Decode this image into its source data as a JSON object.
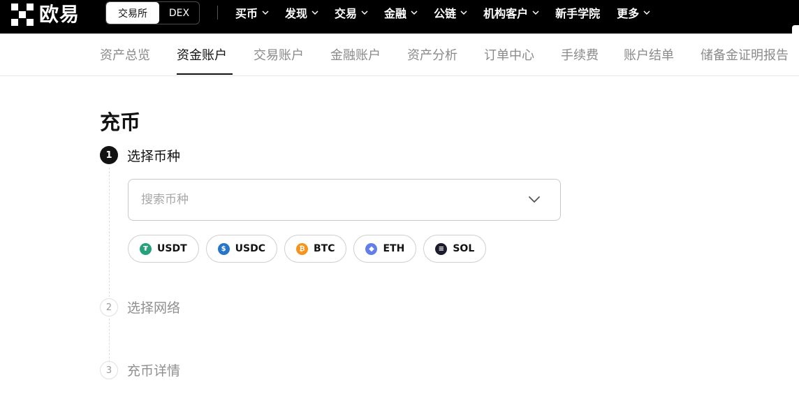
{
  "header": {
    "brand": "欧易",
    "mode_switch": {
      "active": "交易所",
      "other": "DEX"
    },
    "nav": [
      {
        "label": "买币",
        "dropdown": true
      },
      {
        "label": "发现",
        "dropdown": true
      },
      {
        "label": "交易",
        "dropdown": true
      },
      {
        "label": "金融",
        "dropdown": true
      },
      {
        "label": "公链",
        "dropdown": true
      },
      {
        "label": "机构客户",
        "dropdown": true
      },
      {
        "label": "新手学院",
        "dropdown": false
      },
      {
        "label": "更多",
        "dropdown": true
      }
    ]
  },
  "subnav": {
    "tabs": [
      "资产总览",
      "资金账户",
      "交易账户",
      "金融账户",
      "资产分析",
      "订单中心",
      "手续费",
      "账户结单",
      "储备金证明报告"
    ],
    "active_index": 1
  },
  "page": {
    "title": "充币",
    "steps": [
      {
        "number": "1",
        "label": "选择币种",
        "active": true
      },
      {
        "number": "2",
        "label": "选择网络",
        "active": false
      },
      {
        "number": "3",
        "label": "充币详情",
        "active": false
      }
    ],
    "search": {
      "placeholder": "搜索币种",
      "value": ""
    },
    "quick_coins": [
      {
        "symbol": "USDT",
        "icon": "tether-icon",
        "color": "#26a17b",
        "glyph": "₮"
      },
      {
        "symbol": "USDC",
        "icon": "usdc-icon",
        "color": "#2775ca",
        "glyph": "$"
      },
      {
        "symbol": "BTC",
        "icon": "bitcoin-icon",
        "color": "#f7931a",
        "glyph": "₿"
      },
      {
        "symbol": "ETH",
        "icon": "ethereum-icon",
        "color": "#627eea",
        "glyph": "◆"
      },
      {
        "symbol": "SOL",
        "icon": "solana-icon",
        "color": "#1c1c2e",
        "glyph": "≡"
      }
    ]
  }
}
